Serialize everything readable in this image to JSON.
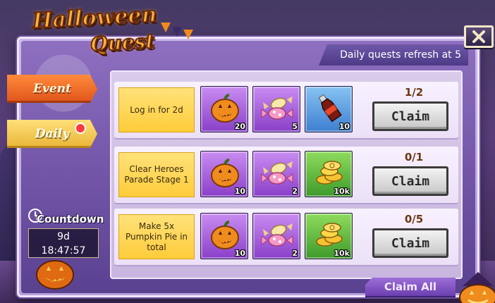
{
  "title": {
    "line1": "Halloween",
    "line2": "Quest"
  },
  "refresh_text": "Daily quests refresh at 5",
  "tabs": [
    {
      "label": "Event",
      "active": true
    },
    {
      "label": "Daily",
      "active": false,
      "has_notification": true
    }
  ],
  "countdown": {
    "label": "Countdown",
    "days": "9d",
    "time": "18:47:57"
  },
  "quests": [
    {
      "description": "Log in for 2d",
      "progress": "1/2",
      "claim_label": "Claim",
      "rewards": [
        {
          "item": "pumpkin-icon",
          "qty": "20",
          "color": "purple"
        },
        {
          "item": "candy-icon",
          "qty": "5",
          "color": "purple"
        },
        {
          "item": "bottle-icon",
          "qty": "10",
          "color": "blue"
        }
      ]
    },
    {
      "description": "Clear Heroes Parade Stage 1",
      "progress": "0/1",
      "claim_label": "Claim",
      "rewards": [
        {
          "item": "pumpkin-icon",
          "qty": "10",
          "color": "purple"
        },
        {
          "item": "candy-icon",
          "qty": "2",
          "color": "purple"
        },
        {
          "item": "gold-coins-icon",
          "qty": "10k",
          "color": "green"
        }
      ]
    },
    {
      "description": "Make 5x Pumpkin Pie in total",
      "progress": "0/5",
      "claim_label": "Claim",
      "rewards": [
        {
          "item": "pumpkin-icon",
          "qty": "10",
          "color": "purple"
        },
        {
          "item": "candy-icon",
          "qty": "2",
          "color": "purple"
        },
        {
          "item": "gold-coins-icon",
          "qty": "10k",
          "color": "green"
        }
      ]
    }
  ],
  "claim_all_label": "Claim All",
  "colors": {
    "accent_orange": "#e0531a",
    "panel_purple": "#6f52a4",
    "quest_yellow": "#ffcc3a"
  }
}
